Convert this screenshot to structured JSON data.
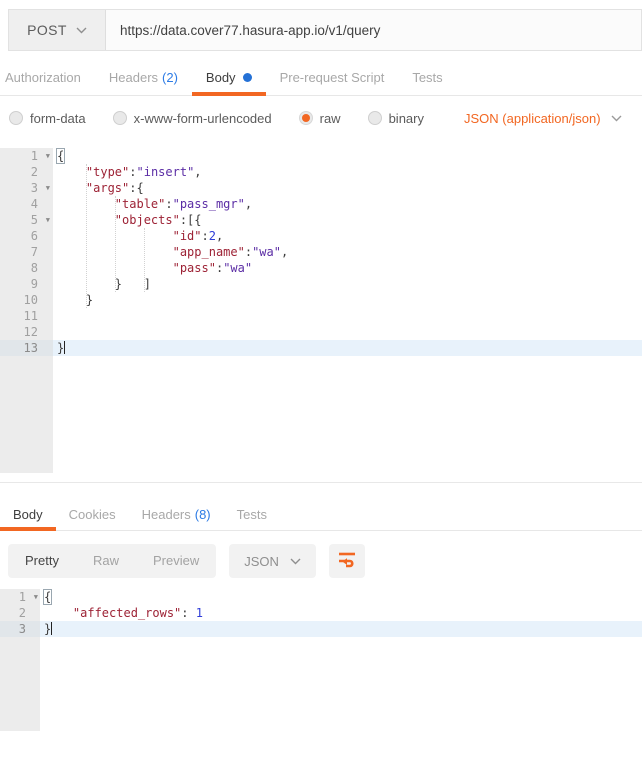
{
  "colors": {
    "accent_orange": "#f26722",
    "count_blue": "#2c7be5",
    "unsaved_dot_blue": "#2471d6",
    "syntax_key": "#9d2235",
    "syntax_string": "#5b2da5",
    "syntax_number": "#2f3dd8",
    "active_line_highlight": "#e8f2fb"
  },
  "request_bar": {
    "method": "POST",
    "url": "https://data.cover77.hasura-app.io/v1/query"
  },
  "request_tabs": {
    "items": [
      {
        "label": "Authorization"
      },
      {
        "label": "Headers",
        "count": "(2)"
      },
      {
        "label": "Body",
        "has_unsaved_dot": true,
        "active": true
      },
      {
        "label": "Pre-request Script"
      },
      {
        "label": "Tests"
      }
    ]
  },
  "body_type_bar": {
    "options": [
      {
        "label": "form-data",
        "selected": false
      },
      {
        "label": "x-www-form-urlencoded",
        "selected": false
      },
      {
        "label": "raw",
        "selected": true
      },
      {
        "label": "binary",
        "selected": false
      }
    ],
    "content_type": "JSON (application/json)"
  },
  "request_editor": {
    "active_line": 13,
    "folded_lines": [
      1,
      3,
      5
    ],
    "lines": [
      [
        [
          "pb",
          "{"
        ]
      ],
      [
        [
          "w",
          "    "
        ],
        [
          "k",
          "\"type\""
        ],
        [
          "p",
          ":"
        ],
        [
          "s",
          "\"insert\""
        ],
        [
          "p",
          ","
        ]
      ],
      [
        [
          "w",
          "    "
        ],
        [
          "k",
          "\"args\""
        ],
        [
          "p",
          ":{"
        ]
      ],
      [
        [
          "w",
          "        "
        ],
        [
          "k",
          "\"table\""
        ],
        [
          "p",
          ":"
        ],
        [
          "s",
          "\"pass_mgr\""
        ],
        [
          "p",
          ","
        ]
      ],
      [
        [
          "w",
          "        "
        ],
        [
          "k",
          "\"objects\""
        ],
        [
          "p",
          ":[{"
        ]
      ],
      [
        [
          "w",
          "                "
        ],
        [
          "k",
          "\"id\""
        ],
        [
          "p",
          ":"
        ],
        [
          "n",
          "2"
        ],
        [
          "p",
          ","
        ]
      ],
      [
        [
          "w",
          "                "
        ],
        [
          "k",
          "\"app_name\""
        ],
        [
          "p",
          ":"
        ],
        [
          "s",
          "\"wa\""
        ],
        [
          "p",
          ","
        ]
      ],
      [
        [
          "w",
          "                "
        ],
        [
          "k",
          "\"pass\""
        ],
        [
          "p",
          ":"
        ],
        [
          "s",
          "\"wa\""
        ]
      ],
      [
        [
          "w",
          "        "
        ],
        [
          "p",
          "}"
        ],
        [
          "w",
          "   "
        ],
        [
          "p",
          "]"
        ]
      ],
      [
        [
          "w",
          "    "
        ],
        [
          "p",
          "}"
        ]
      ],
      [],
      [],
      [
        [
          "p",
          "}"
        ]
      ]
    ]
  },
  "response_tabs": {
    "items": [
      {
        "label": "Body",
        "active": true
      },
      {
        "label": "Cookies"
      },
      {
        "label": "Headers",
        "count": "(8)"
      },
      {
        "label": "Tests"
      }
    ]
  },
  "response_toolbar": {
    "views": [
      "Pretty",
      "Raw",
      "Preview"
    ],
    "active_view": "Pretty",
    "format": "JSON",
    "wrap_icon": "wrap-text-icon"
  },
  "response_editor": {
    "active_line": 3,
    "folded_lines": [
      1
    ],
    "lines": [
      [
        [
          "pb",
          "{"
        ]
      ],
      [
        [
          "w",
          "    "
        ],
        [
          "k",
          "\"affected_rows\""
        ],
        [
          "p",
          ":"
        ],
        [
          "w",
          " "
        ],
        [
          "n",
          "1"
        ]
      ],
      [
        [
          "p",
          "}"
        ]
      ]
    ]
  }
}
